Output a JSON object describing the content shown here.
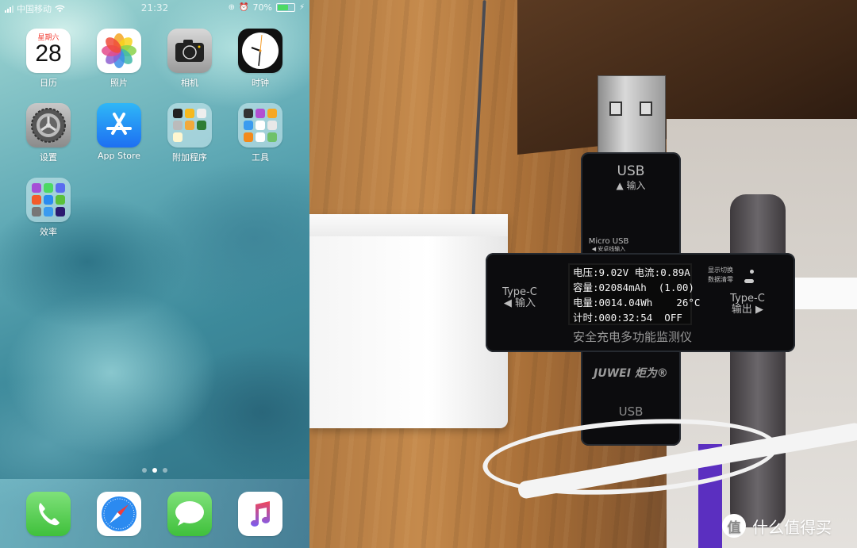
{
  "status_bar": {
    "carrier": "中国移动",
    "time": "21:32",
    "battery_percent": "70%",
    "battery_level": 0.7,
    "icons": [
      "signal-icon",
      "wifi-icon",
      "orientation-lock-icon",
      "alarm-icon",
      "battery-icon",
      "charging-icon"
    ]
  },
  "home_screen": {
    "apps": [
      {
        "name": "日历",
        "icon": "calendar-icon",
        "weekday": "星期六",
        "day": "28"
      },
      {
        "name": "照片",
        "icon": "photos-icon"
      },
      {
        "name": "相机",
        "icon": "camera-icon"
      },
      {
        "name": "时钟",
        "icon": "clock-icon"
      },
      {
        "name": "设置",
        "icon": "settings-gear-icon"
      },
      {
        "name": "App Store",
        "icon": "app-store-icon"
      },
      {
        "name": "附加程序",
        "icon": "folder-icon"
      },
      {
        "name": "工具",
        "icon": "folder-icon"
      },
      {
        "name": "效率",
        "icon": "folder-icon"
      }
    ],
    "page_dots": {
      "count": 3,
      "active": 2
    },
    "dock": [
      {
        "name": "Phone",
        "icon": "phone-icon"
      },
      {
        "name": "Safari",
        "icon": "safari-compass-icon"
      },
      {
        "name": "Messages",
        "icon": "message-bubble-icon"
      },
      {
        "name": "Music",
        "icon": "music-note-icon"
      }
    ]
  },
  "photo": {
    "tester": {
      "top_port": "USB",
      "top_port_sub": "▲ 输入",
      "micro_usb": "Micro USB",
      "micro_usb_sub": "◀ 安卓线输入",
      "left_port": "Type-C",
      "left_port_sub": "◀ 输入",
      "right_port": "Type-C",
      "right_port_sub": "输出 ▶",
      "button_label_1": "显示切换",
      "button_label_2": "数据清零",
      "screen_lines": [
        "电压:9.02V 电流:0.89A",
        "容量:02084mAh  (1.00)",
        "电量:0014.04Wh    26°C",
        "计时:000:32:54  OFF"
      ],
      "product_name": "安全充电多功能监测仪",
      "brand": "JUWEI 炬为®",
      "bottom_port": "USB"
    },
    "watermark": {
      "badge": "值",
      "text": "什么值得买"
    }
  },
  "colors": {
    "calendar_weekday": "#f23b31",
    "battery_fill": "#4cd964",
    "app_store_blue": "#1d6ff2"
  }
}
